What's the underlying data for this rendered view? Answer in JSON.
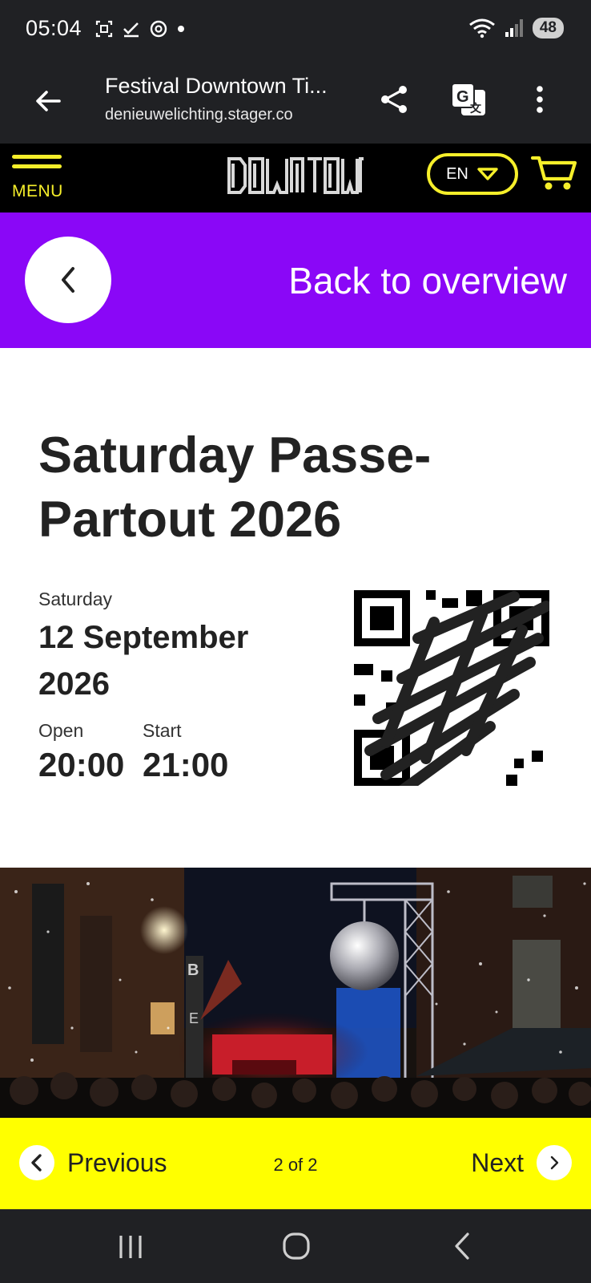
{
  "status_bar": {
    "time": "05:04",
    "battery": "48",
    "icons": [
      "screenshot-icon",
      "check-icon",
      "threads-icon",
      "dot-icon",
      "wifi-icon",
      "signal-icon"
    ]
  },
  "browser": {
    "title": "Festival Downtown Ti...",
    "url": "denieuwelichting.stager.co",
    "icons": [
      "back-arrow-icon",
      "share-icon",
      "translate-icon",
      "more-vert-icon"
    ]
  },
  "header": {
    "menu_label": "MENU",
    "language": "EN",
    "brand_color": "#f6ef2a",
    "logo_alt": "DOWNTOWN"
  },
  "back_bar": {
    "label": "Back to overview",
    "color": "#8a07f7"
  },
  "ticket": {
    "title": "Saturday Passe-Partout 2026",
    "day": "Saturday",
    "date": "12 September 2026",
    "open_label": "Open",
    "open_time": "20:00",
    "start_label": "Start",
    "start_time": "21:00"
  },
  "pager": {
    "prev_label": "Previous",
    "next_label": "Next",
    "count": "2 of 2",
    "color": "#ffff00"
  },
  "nav_bar": {
    "icons": [
      "recent-apps-icon",
      "home-icon",
      "back-icon"
    ]
  }
}
